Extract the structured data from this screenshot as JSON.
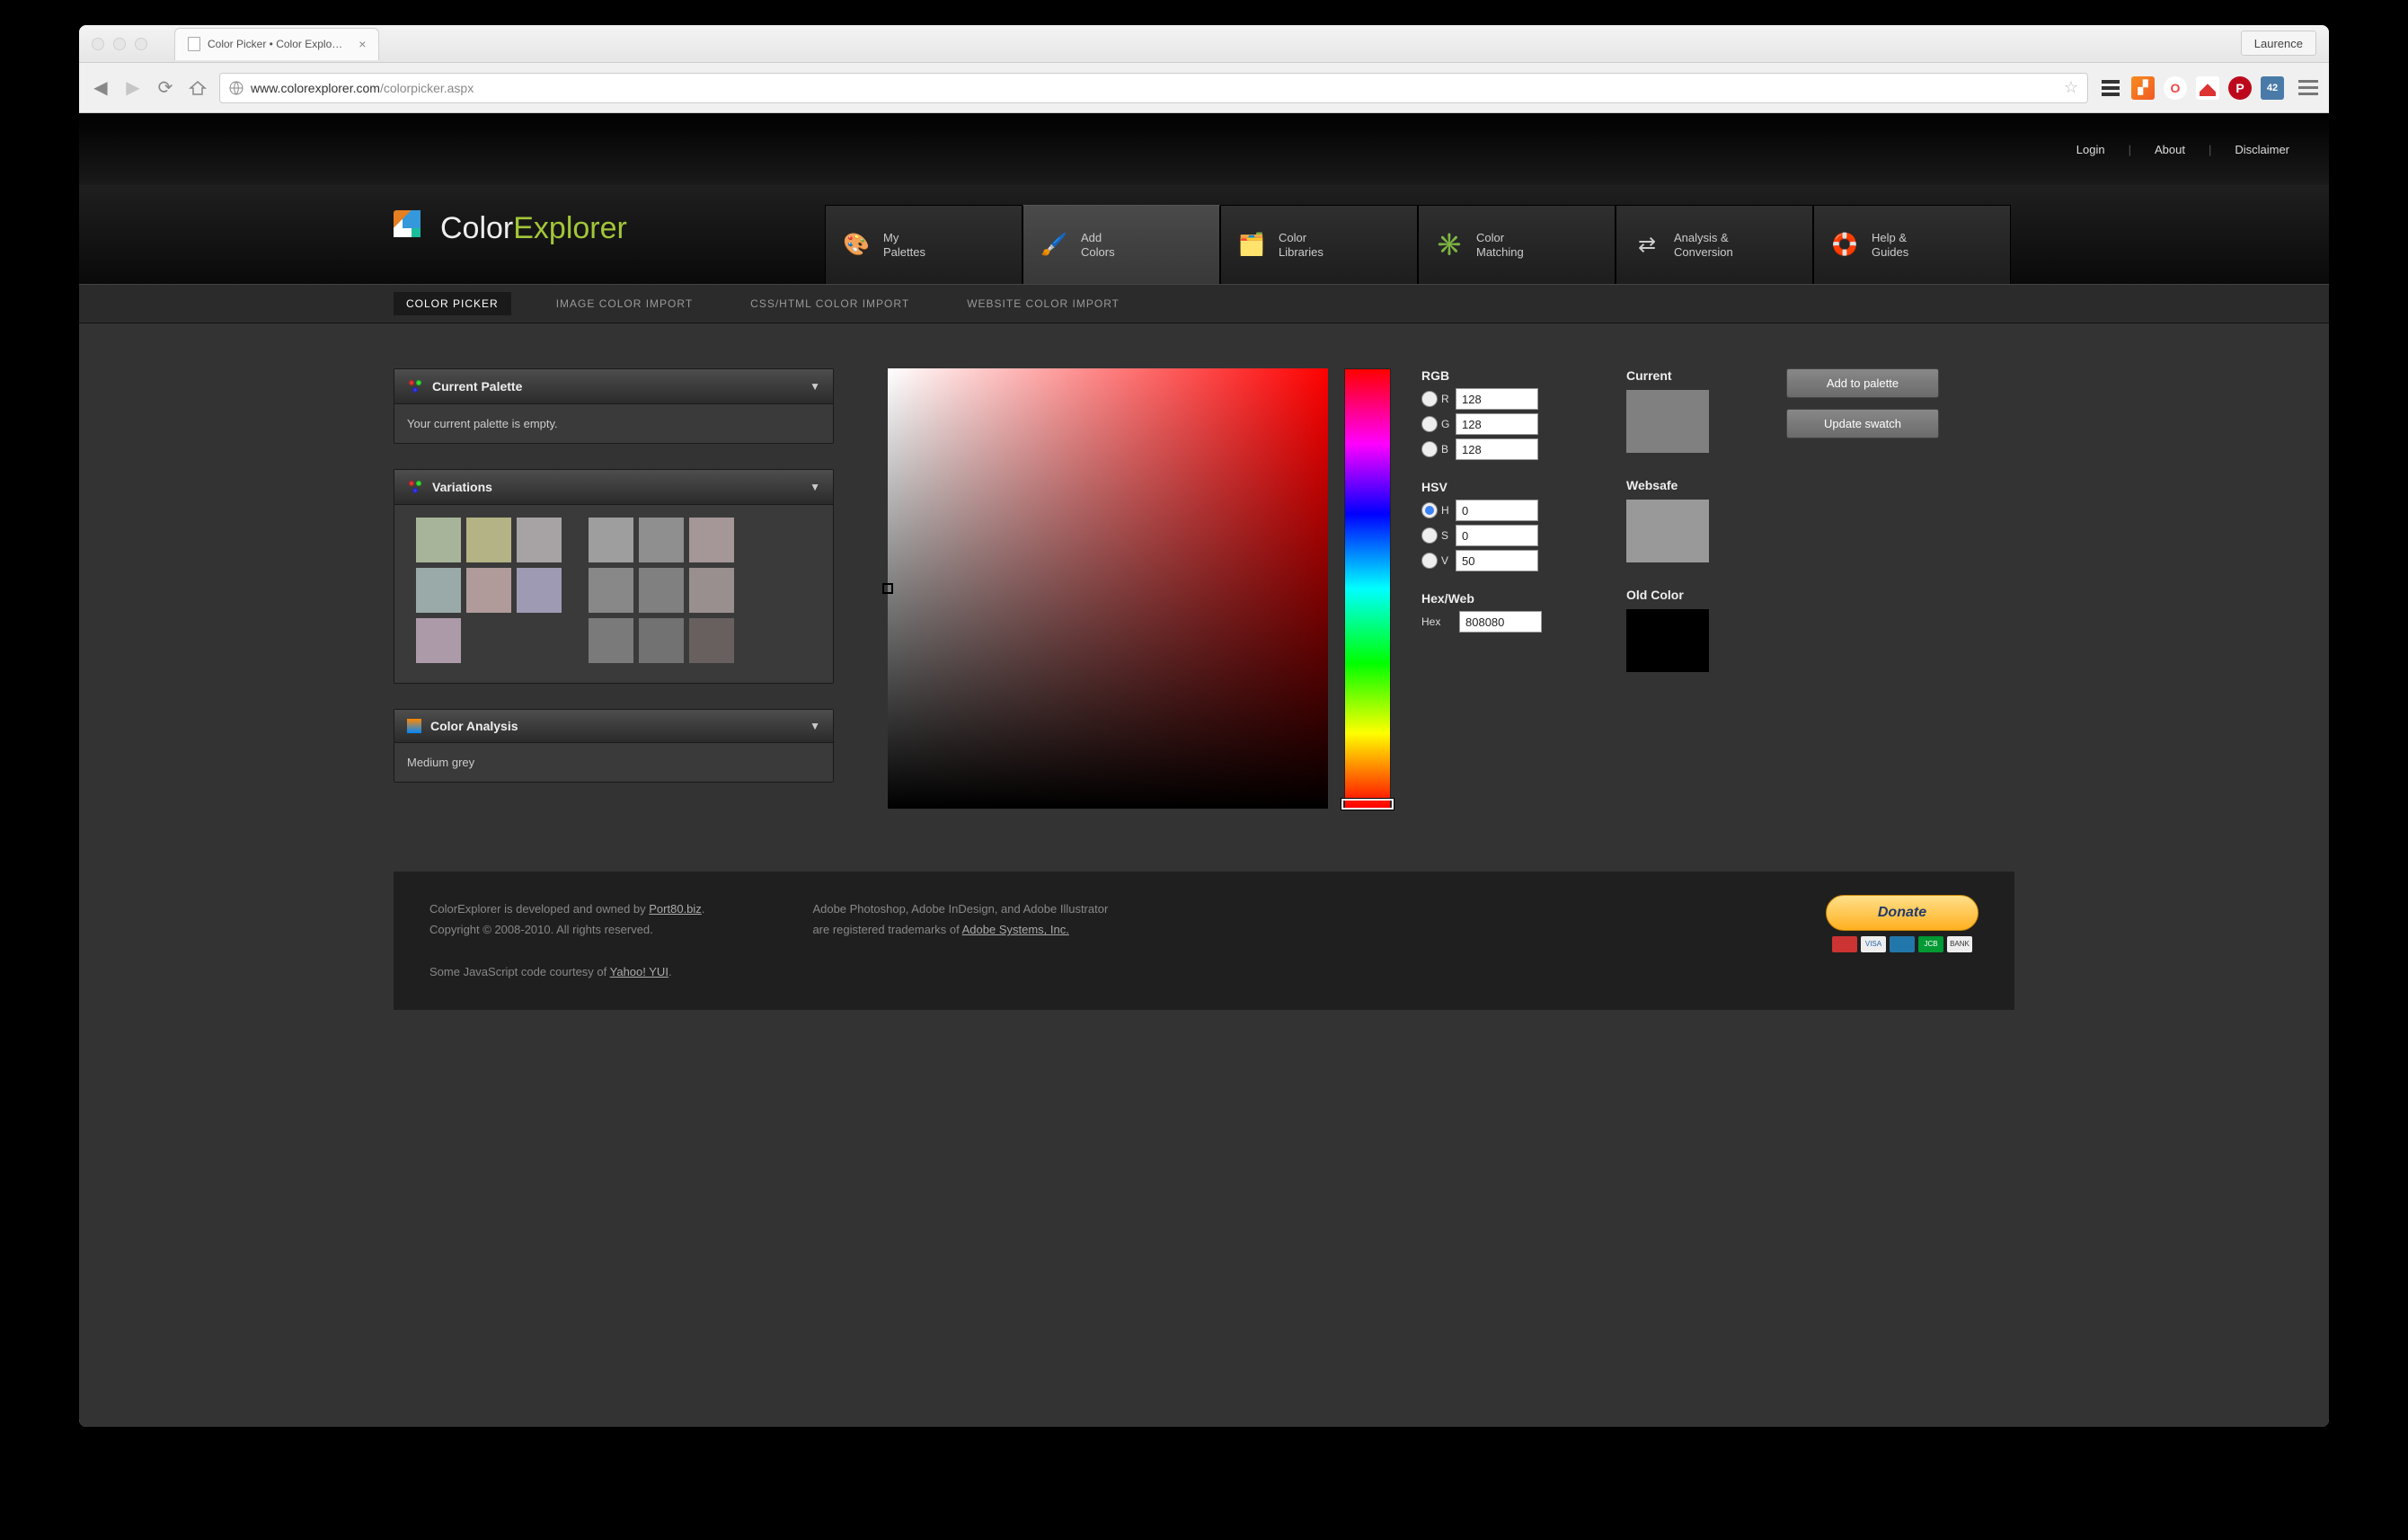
{
  "browser": {
    "tab_title": "Color Picker • Color Explo…",
    "profile_name": "Laurence",
    "url_host": "www.colorexplorer.com",
    "url_path": "/colorpicker.aspx"
  },
  "top_links": {
    "login": "Login",
    "about": "About",
    "disclaimer": "Disclaimer"
  },
  "logo": {
    "part1": "Color",
    "part2": "Explorer"
  },
  "main_tabs": [
    {
      "line1": "My",
      "line2": "Palettes"
    },
    {
      "line1": "Add",
      "line2": "Colors"
    },
    {
      "line1": "Color",
      "line2": "Libraries"
    },
    {
      "line1": "Color",
      "line2": "Matching"
    },
    {
      "line1": "Analysis &",
      "line2": "Conversion"
    },
    {
      "line1": "Help &",
      "line2": "Guides"
    }
  ],
  "sub_tabs": [
    "COLOR PICKER",
    "IMAGE COLOR IMPORT",
    "CSS/HTML COLOR IMPORT",
    "WEBSITE COLOR IMPORT"
  ],
  "sidebar": {
    "current_palette_title": "Current Palette",
    "current_palette_empty": "Your current palette is empty.",
    "variations_title": "Variations",
    "variations_left": [
      "#a7b49a",
      "#b3b385",
      "#a7a3a5",
      "#9aaaa9",
      "#b09a9a",
      "#9e9ab3",
      "#ad9aa9"
    ],
    "variations_right": [
      "#9e9e9e",
      "#8f8f8f",
      "#a59797",
      "#888888",
      "#808080",
      "#9a8f8f",
      "#7a7a7a",
      "#727272",
      "#685f5f"
    ],
    "color_analysis_title": "Color Analysis",
    "color_analysis_text": "Medium grey"
  },
  "inputs": {
    "rgb_heading": "RGB",
    "r": "128",
    "g": "128",
    "b": "128",
    "hsv_heading": "HSV",
    "h": "0",
    "s": "0",
    "v": "50",
    "hexweb_heading": "Hex/Web",
    "hex_label": "Hex",
    "hex": "808080"
  },
  "preview": {
    "current_label": "Current",
    "current_color": "#808080",
    "websafe_label": "Websafe",
    "websafe_color": "#999999",
    "old_label": "Old Color",
    "old_color": "#000000"
  },
  "actions": {
    "add_to_palette": "Add to palette",
    "update_swatch": "Update swatch"
  },
  "footer": {
    "line1a": "ColorExplorer is developed and owned by ",
    "line1b": "Port80.biz",
    "line2": "Copyright © 2008-2010. All rights reserved.",
    "line3a": "Some JavaScript code courtesy of ",
    "line3b": "Yahoo! YUI",
    "right1": "Adobe Photoshop, Adobe InDesign, and Adobe Illustrator",
    "right2a": "are registered trademarks of ",
    "right2b": "Adobe Systems, Inc.",
    "donate": "Donate"
  }
}
